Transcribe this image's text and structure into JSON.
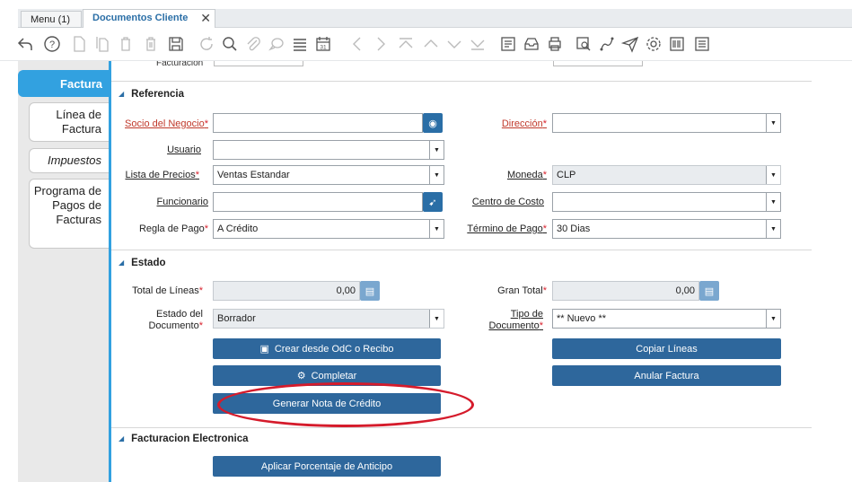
{
  "tabs": {
    "menu": "Menu (1)",
    "document": "Documentos Cliente",
    "close_glyph": "✕"
  },
  "toolbar": {
    "icons": [
      "undo-icon",
      "help-icon",
      "new-record-icon",
      "copy-record-icon",
      "delete-icon",
      "delete-selected-icon",
      "save-icon",
      "refresh-icon",
      "find-icon",
      "attachment-icon",
      "chat-icon",
      "grid-toggle-icon",
      "calendar-icon",
      "previous-record-icon",
      "next-record-icon",
      "first-record-icon",
      "previous-page-icon",
      "next-page-icon",
      "last-record-icon",
      "report-icon",
      "archive-icon",
      "print-icon",
      "zoom-across-icon",
      "workflow-icon",
      "send-icon",
      "process-icon",
      "barcode-icon",
      "detail-icon"
    ],
    "calendar_day": "31"
  },
  "sidebar": {
    "items": [
      {
        "label": "Factura"
      },
      {
        "label": "Línea de Factura"
      },
      {
        "label": "Impuestos"
      },
      {
        "label": "Programa de Pagos de Facturas"
      }
    ]
  },
  "top_cut": {
    "label": "Facturación"
  },
  "referencia": {
    "title": "Referencia",
    "socio_label": "Socio del Negocio",
    "direccion_label": "Dirección",
    "usuario_label": "Usuario",
    "lista_label": "Lista de Precios",
    "lista_value": "Ventas Estandar",
    "moneda_label": "Moneda",
    "moneda_value": "CLP",
    "funcionario_label": "Funcionario",
    "centro_label": "Centro de Costo",
    "regla_label": "Regla de Pago",
    "regla_value": "A Crédito",
    "termino_label": "Término de Pago",
    "termino_value": "30 Dias"
  },
  "estado": {
    "title": "Estado",
    "total_lineas_label": "Total de Líneas",
    "total_lineas_value": "0,00",
    "gran_total_label": "Gran Total",
    "gran_total_value": "0,00",
    "estado_doc_label_1": "Estado del",
    "estado_doc_label_2": "Documento",
    "estado_doc_value": "Borrador",
    "tipo_doc_label_1": "Tipo de",
    "tipo_doc_label_2": "Documento",
    "tipo_doc_value": "** Nuevo **",
    "btn_crear": "Crear desde OdC o Recibo",
    "btn_copiar": "Copiar Líneas",
    "btn_completar": "Completar",
    "btn_anular": "Anular Factura",
    "btn_nota_credito": "Generar Nota de Crédito"
  },
  "facturacion": {
    "title": "Facturacion Electronica",
    "btn_anticipo": "Aplicar Porcentaje de Anticipo"
  },
  "colors": {
    "accent": "#32a1e0",
    "button": "#2e679c",
    "required": "#d9232e",
    "highlight_oval": "#d51b2b"
  }
}
